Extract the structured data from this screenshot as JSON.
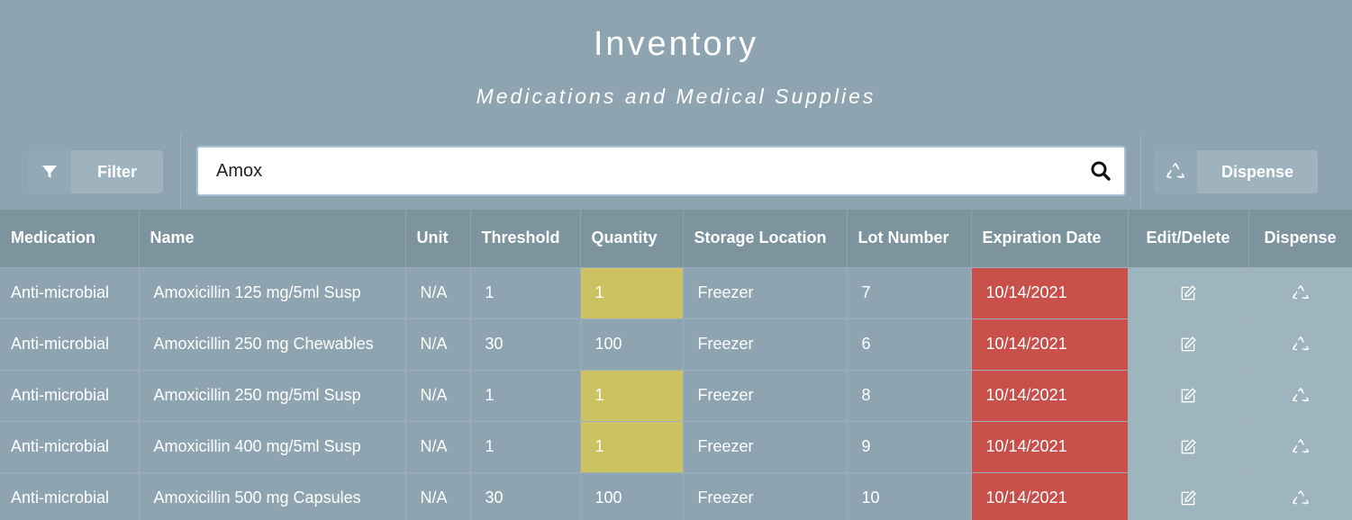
{
  "header": {
    "title": "Inventory",
    "subtitle": "Medications and Medical Supplies"
  },
  "toolbar": {
    "filter_label": "Filter",
    "search_value": "Amox",
    "dispense_label": "Dispense"
  },
  "table": {
    "columns": [
      "Medication",
      "Name",
      "Unit",
      "Threshold",
      "Quantity",
      "Storage Location",
      "Lot Number",
      "Expiration Date",
      "Edit/Delete",
      "Dispense"
    ],
    "rows": [
      {
        "medication": "Anti-microbial",
        "name": "Amoxicillin 125 mg/5ml Susp",
        "unit": "N/A",
        "threshold": "1",
        "quantity": "1",
        "storage": "Freezer",
        "lot": "7",
        "expiration": "10/14/2021",
        "low_stock": true,
        "expired": true
      },
      {
        "medication": "Anti-microbial",
        "name": "Amoxicillin 250 mg Chewables",
        "unit": "N/A",
        "threshold": "30",
        "quantity": "100",
        "storage": "Freezer",
        "lot": "6",
        "expiration": "10/14/2021",
        "low_stock": false,
        "expired": true
      },
      {
        "medication": "Anti-microbial",
        "name": "Amoxicillin 250 mg/5ml Susp",
        "unit": "N/A",
        "threshold": "1",
        "quantity": "1",
        "storage": "Freezer",
        "lot": "8",
        "expiration": "10/14/2021",
        "low_stock": true,
        "expired": true
      },
      {
        "medication": "Anti-microbial",
        "name": "Amoxicillin 400 mg/5ml Susp",
        "unit": "N/A",
        "threshold": "1",
        "quantity": "1",
        "storage": "Freezer",
        "lot": "9",
        "expiration": "10/14/2021",
        "low_stock": true,
        "expired": true
      },
      {
        "medication": "Anti-microbial",
        "name": "Amoxicillin 500 mg Capsules",
        "unit": "N/A",
        "threshold": "30",
        "quantity": "100",
        "storage": "Freezer",
        "lot": "10",
        "expiration": "10/14/2021",
        "low_stock": false,
        "expired": true
      }
    ]
  },
  "icons": {
    "filter": "filter-icon",
    "search": "search-icon",
    "dispense": "recycle-icon",
    "edit": "edit-icon"
  },
  "colors": {
    "background": "#8ea5b1",
    "header_row": "#7d939e",
    "low_stock": "#cdc261",
    "expired": "#c94f4b"
  }
}
